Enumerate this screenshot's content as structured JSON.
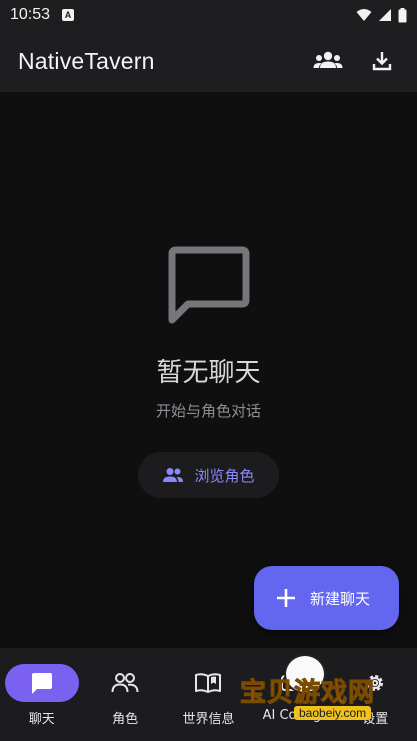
{
  "status_bar": {
    "time": "10:53",
    "notification_letter": "A"
  },
  "app_bar": {
    "title": "NativeTavern",
    "actions": [
      {
        "icon": "group-icon"
      },
      {
        "icon": "download-icon"
      }
    ]
  },
  "empty_state": {
    "icon": "chat-bubble-icon",
    "title": "暂无聊天",
    "subtitle": "开始与角色对话",
    "browse_button": {
      "icon": "people-icon",
      "label": "浏览角色"
    }
  },
  "fab": {
    "icon": "plus-icon",
    "label": "新建聊天"
  },
  "bottom_nav": {
    "items": [
      {
        "label": "聊天",
        "icon": "chat-icon",
        "active": true
      },
      {
        "label": "角色",
        "icon": "people-icon",
        "active": false
      },
      {
        "label": "世界信息",
        "icon": "book-icon",
        "active": false
      },
      {
        "label": "AI Config",
        "icon": "ai-config-icon",
        "active": false
      },
      {
        "label": "设置",
        "icon": "gear-icon",
        "active": false
      }
    ]
  },
  "watermark": {
    "text": "宝贝游戏网",
    "url": "baobeiy.com"
  },
  "colors": {
    "accent": "#6366ee",
    "nav_active": "#7b61f0",
    "background": "#0f0f10",
    "bar": "#1e1e20"
  }
}
